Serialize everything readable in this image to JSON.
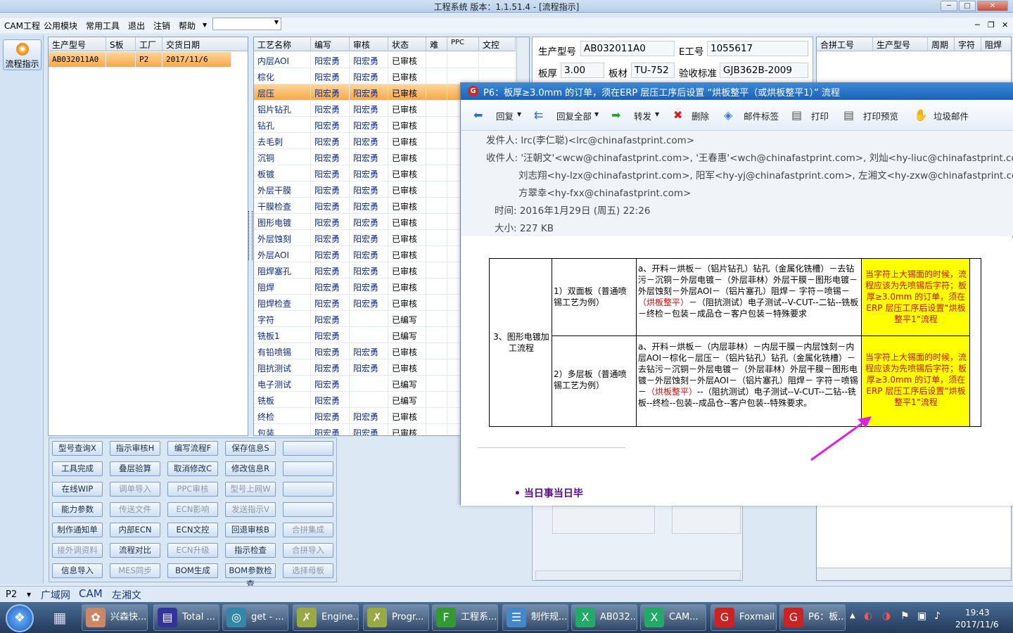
{
  "window": {
    "title": "工程系统    版本：1.1.51.4 - [流程指示]",
    "faded_logo": "Planner"
  },
  "menu": [
    "CAM工程",
    "公用模块",
    "常用工具",
    "退出",
    "注销",
    "帮助"
  ],
  "menu_combo_value": "",
  "left_nav": {
    "button": "流程指示",
    "icon": "flow-indicator-icon"
  },
  "order_grid": {
    "headers": [
      "生产型号",
      "S板",
      "工厂",
      "交货日期"
    ],
    "rows": [
      [
        "AB032011A0",
        "",
        "P2",
        "2017/11/6"
      ]
    ]
  },
  "process_grid": {
    "headers": [
      "工艺名称",
      "编写",
      "审核",
      "状态",
      "难",
      "PPC",
      "文控"
    ],
    "rows": [
      [
        "内层AOI",
        "阳宏勇",
        "阳宏勇",
        "已审核"
      ],
      [
        "棕化",
        "阳宏勇",
        "阳宏勇",
        "已审核"
      ],
      [
        "层压",
        "阳宏勇",
        "阳宏勇",
        "已审核"
      ],
      [
        "铝片钻孔",
        "阳宏勇",
        "阳宏勇",
        "已审核"
      ],
      [
        "钻孔",
        "阳宏勇",
        "阳宏勇",
        "已审核"
      ],
      [
        "去毛刺",
        "阳宏勇",
        "阳宏勇",
        "已审核"
      ],
      [
        "沉铜",
        "阳宏勇",
        "阳宏勇",
        "已审核"
      ],
      [
        "板镀",
        "阳宏勇",
        "阳宏勇",
        "已审核"
      ],
      [
        "外层干膜",
        "阳宏勇",
        "阳宏勇",
        "已审核"
      ],
      [
        "干膜检查",
        "阳宏勇",
        "阳宏勇",
        "已审核"
      ],
      [
        "图形电镀",
        "阳宏勇",
        "阳宏勇",
        "已审核"
      ],
      [
        "外层蚀刻",
        "阳宏勇",
        "阳宏勇",
        "已审核"
      ],
      [
        "外层AOI",
        "阳宏勇",
        "阳宏勇",
        "已审核"
      ],
      [
        "阻焊塞孔",
        "阳宏勇",
        "阳宏勇",
        "已审核"
      ],
      [
        "阻焊",
        "阳宏勇",
        "阳宏勇",
        "已审核"
      ],
      [
        "阻焊检查",
        "阳宏勇",
        "阳宏勇",
        "已审核"
      ],
      [
        "字符",
        "阳宏勇",
        "",
        "已编写"
      ],
      [
        "铣板1",
        "阳宏勇",
        "",
        "已编写"
      ],
      [
        "有铅喷锡",
        "阳宏勇",
        "阳宏勇",
        "已审核"
      ],
      [
        "阻抗测试",
        "阳宏勇",
        "阳宏勇",
        "已审核"
      ],
      [
        "电子测试",
        "阳宏勇",
        "",
        "已编写"
      ],
      [
        "铣板",
        "阳宏勇",
        "",
        "已编写"
      ],
      [
        "终检",
        "阳宏勇",
        "阳宏勇",
        "已审核"
      ],
      [
        "包装",
        "阳宏勇",
        "阳宏勇",
        "已审核"
      ]
    ]
  },
  "buttons": [
    [
      "型号查询X",
      "指示审核H",
      "编写流程F",
      "保存信息S",
      ""
    ],
    [
      "工具完成",
      "叠层验算",
      "取消修改C",
      "修改信息R",
      ""
    ],
    [
      "在线WIP",
      "调单导入",
      "PPC审核",
      "型号上网W",
      ""
    ],
    [
      "能力参数",
      "传送文件",
      "ECN影响",
      "发送指示V",
      ""
    ],
    [
      "制作通知单",
      "内部ECN",
      "ECN文控",
      "回退审核B",
      "合拼集成"
    ],
    [
      "接外调资料",
      "流程对比",
      "ECN升级",
      "指示检查",
      "合拼导入"
    ],
    [
      "信息导入",
      "MES同步",
      "BOM生成",
      "BOM参数检查",
      "选择母板"
    ]
  ],
  "info": {
    "model_label": "生产型号",
    "model": "AB032011A0",
    "e_label": "E工号",
    "e_value": "1055617",
    "thick_label": "板厚",
    "thick": "3.00",
    "mat_label": "板材",
    "mat": "TU-752",
    "std_label": "验收标准",
    "std": "GJB362B-2009"
  },
  "merge_grid": {
    "headers": [
      "合拼工号",
      "生产型号",
      "周期",
      "字符",
      "阻焊"
    ]
  },
  "mail": {
    "title": "P6：板厚≥3.0mm 的订单，须在ERP 层压工序后设置 “烘板整平（或烘板整平1）” 流程",
    "toolbar": [
      "回复",
      "回复全部",
      "转发",
      "删除",
      "邮件标签",
      "打印",
      "打印预览",
      "垃圾邮件"
    ],
    "from": "发件人: lrc(李仁聪)<lrc@chinafastprint.com>",
    "to1": "收件人: '汪朝文'<wcw@chinafastprint.com>, '王春惠'<wch@chinafastprint.com>, 刘灿<hy-liuc@chinafastprint.com>,",
    "to2": "刘志翔<hy-lzx@chinafastprint.com>, 阳军<hy-yj@chinafastprint.com>, 左湘文<hy-zxw@chinafastprint.com>,",
    "to3": "方翠幸<hy-fxx@chinafastprint.com>",
    "time": "时间: 2016年1月29日 (周五) 22:26",
    "size": "大小: 227 KB",
    "table": {
      "section": "3、图形电镀加工流程",
      "row1_type": "1）双面板（普通喷锡工艺为例）",
      "row1_pre": "a、开料－烘板－（铝片钻孔）钻孔（金属化铣槽）－去钻污－沉铜－外层电镀－（外层菲林）外层干膜－图形电镀－外层蚀刻－外层AOI－（铝片塞孔）阻焊－ 字符－喷锡－",
      "row1_red": "（烘板整平）",
      "row1_post": "－（阻抗测试）电子测试--V-CUT--二钻--铣板－终检－包装－成品仓－客户包装－特殊要求",
      "row2_type": "2）多层板（普通喷锡工艺为例）",
      "row2_pre": "a、开料－烘板－（内层菲林）－内层干膜－内层蚀刻－内层AOI－棕化－层压－（铝片钻孔）钻孔（金属化铣槽）－去钻污－沉铜－外层电镀－（外层菲林）外层干膜－图形电镀－外层蚀刻－外层AOI－（铝片塞孔）阻焊－ 字符－喷锡－",
      "row2_red": "（烘板整平）",
      "row2_post": "--（阻抗测试）电子测试--V-CUT--二钻--铣板--终检--包装--成品仓--客户包装--特殊要求。",
      "note": "当字符上大锡面的时候，流程应该为先喷锡后字符；板厚≥3.0mm 的订单，须在ERP 层压工序后设置“烘板整平1”流程"
    },
    "bullet": "当日事当日毕"
  },
  "status_bar": [
    "P2",
    "广域网",
    "CAM",
    "左湘文"
  ],
  "taskbar": {
    "items": [
      "兴森快...",
      "Total ...",
      "get - ...",
      "Engine...",
      "Progr...",
      "工程系...",
      "制作规...",
      "AB032...",
      "CAM...",
      "Foxmail",
      "P6：板..."
    ],
    "time": "19:43",
    "date": "2017/11/6"
  },
  "colors": {
    "accent": "#1d62b5",
    "selected_row": "#f6a94a",
    "highlight": "#ffff00",
    "arrow": "#e020e0"
  }
}
